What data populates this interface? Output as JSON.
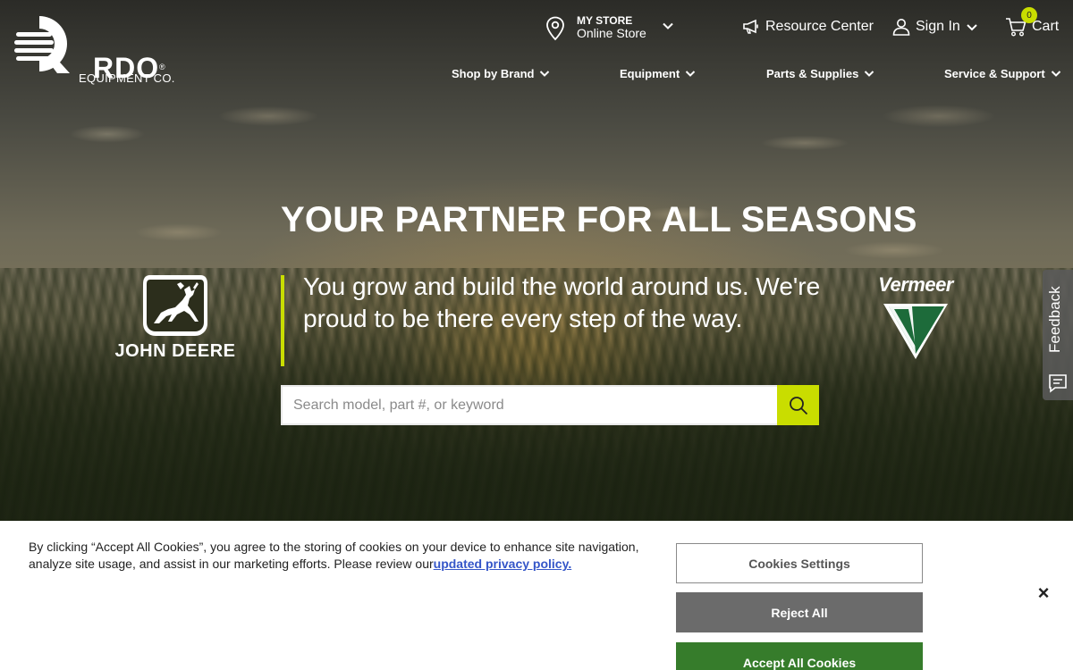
{
  "brand": {
    "logo_text": "RDO",
    "logo_sub": "EQUIPMENT CO.",
    "logo_reg": "®"
  },
  "store": {
    "label": "MY STORE",
    "value": "Online Store"
  },
  "top_links": {
    "resource_center": "Resource Center",
    "sign_in": "Sign In",
    "cart": "Cart",
    "cart_count": "0"
  },
  "nav": {
    "items": [
      {
        "label": "Shop by Brand"
      },
      {
        "label": "Equipment"
      },
      {
        "label": "Parts & Supplies"
      },
      {
        "label": "Service & Support"
      }
    ]
  },
  "hero": {
    "headline": "YOUR PARTNER FOR ALL SEASONS",
    "tagline": "You grow and build the world around us. We're proud to be there every step of the way.",
    "search_placeholder": "Search model, part #, or keyword",
    "brands": {
      "left": "JOHN DEERE",
      "right": "Vermeer"
    }
  },
  "feedback": {
    "label": "Feedback"
  },
  "cookie": {
    "text": "By clicking “Accept All Cookies”, you agree to the storing of cookies on your device to enhance site navigation, analyze site usage, and assist in our marketing efforts. Please review our",
    "link": "updated privacy policy.",
    "settings": "Cookies Settings",
    "reject": "Reject All",
    "accept": "Accept All Cookies",
    "close": "×"
  },
  "colors": {
    "accent": "#c9dd00",
    "accept_green": "#367c2b",
    "reject_gray": "#6b6b6b",
    "link_blue": "#3556c8"
  }
}
